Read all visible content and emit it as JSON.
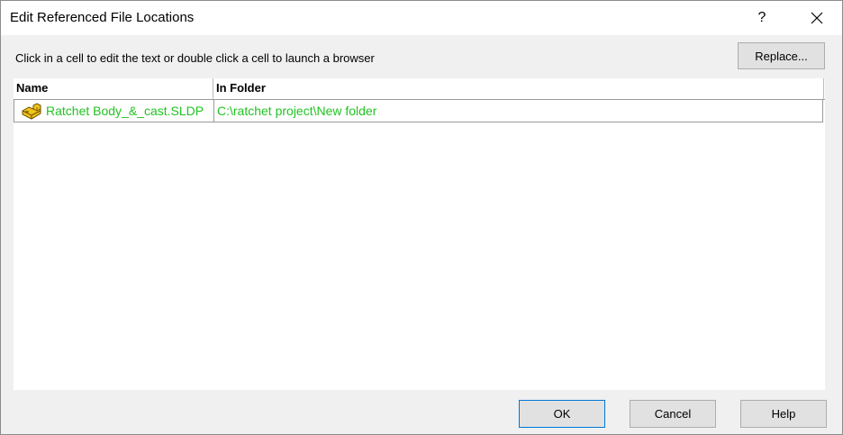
{
  "window": {
    "title": "Edit Referenced File Locations",
    "help_label": "?",
    "close_icon": "close-icon"
  },
  "instruction": "Click in a cell to edit the text or double click a cell to launch a browser",
  "replace_label": "Replace...",
  "table": {
    "columns": [
      "Name",
      "In Folder"
    ],
    "rows": [
      {
        "name": "Ratchet Body_&_cast.SLDP",
        "folder": "C:\\ratchet project\\New folder",
        "icon": "part-icon",
        "color": "#22c322"
      }
    ]
  },
  "footer": {
    "ok_label": "OK",
    "cancel_label": "Cancel",
    "help_label": "Help"
  }
}
